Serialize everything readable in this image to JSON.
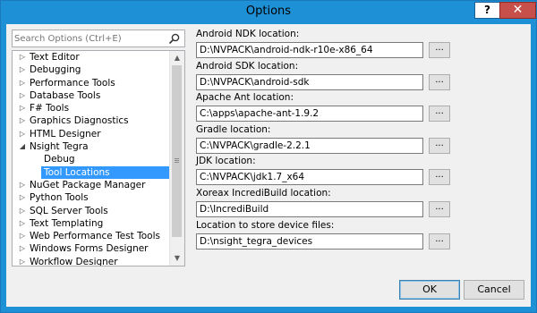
{
  "window": {
    "title": "Options",
    "help_label": "?",
    "close_label": "✕"
  },
  "search": {
    "placeholder": "Search Options (Ctrl+E)",
    "value": "",
    "icon": "search-icon"
  },
  "tree": {
    "items": [
      {
        "label": "Text Editor",
        "expander": "▷",
        "level": 0
      },
      {
        "label": "Debugging",
        "expander": "▷",
        "level": 0
      },
      {
        "label": "Performance Tools",
        "expander": "▷",
        "level": 0
      },
      {
        "label": "Database Tools",
        "expander": "▷",
        "level": 0
      },
      {
        "label": "F# Tools",
        "expander": "▷",
        "level": 0
      },
      {
        "label": "Graphics Diagnostics",
        "expander": "▷",
        "level": 0
      },
      {
        "label": "HTML Designer",
        "expander": "▷",
        "level": 0
      },
      {
        "label": "Nsight Tegra",
        "expander": "◢",
        "level": 0
      },
      {
        "label": "Debug",
        "expander": "",
        "level": 1
      },
      {
        "label": "Tool Locations",
        "expander": "",
        "level": 1,
        "selected": true
      },
      {
        "label": "NuGet Package Manager",
        "expander": "▷",
        "level": 0
      },
      {
        "label": "Python Tools",
        "expander": "▷",
        "level": 0
      },
      {
        "label": "SQL Server Tools",
        "expander": "▷",
        "level": 0
      },
      {
        "label": "Text Templating",
        "expander": "▷",
        "level": 0
      },
      {
        "label": "Web Performance Test Tools",
        "expander": "▷",
        "level": 0
      },
      {
        "label": "Windows Forms Designer",
        "expander": "▷",
        "level": 0
      },
      {
        "label": "Workflow Designer",
        "expander": "▷",
        "level": 0
      },
      {
        "label": "",
        "expander": "▷",
        "level": 0
      }
    ],
    "scroll_up": "▲",
    "scroll_down": "▼"
  },
  "fields": [
    {
      "label": "Android NDK location:",
      "value": "D:\\NVPACK\\android-ndk-r10e-x86_64",
      "browse_label": "..."
    },
    {
      "label": "Android SDK location:",
      "value": "D:\\NVPACK\\android-sdk",
      "browse_label": "..."
    },
    {
      "label": "Apache Ant location:",
      "value": "C:\\apps\\apache-ant-1.9.2",
      "browse_label": "..."
    },
    {
      "label": "Gradle location:",
      "value": "C:\\NVPACK\\gradle-2.2.1",
      "browse_label": "..."
    },
    {
      "label": "JDK location:",
      "value": "C:\\NVPACK\\jdk1.7_x64",
      "browse_label": "..."
    },
    {
      "label": "Xoreax IncrediBuild location:",
      "value": "D:\\IncrediBuild",
      "browse_label": "..."
    },
    {
      "label": "Location to store device files:",
      "value": "D:\\nsight_tegra_devices",
      "browse_label": "..."
    }
  ],
  "buttons": {
    "ok_label": "OK",
    "cancel_label": "Cancel"
  },
  "colors": {
    "titlebar": "#1e90d6",
    "close": "#c7504a",
    "selection": "#3399ff"
  }
}
